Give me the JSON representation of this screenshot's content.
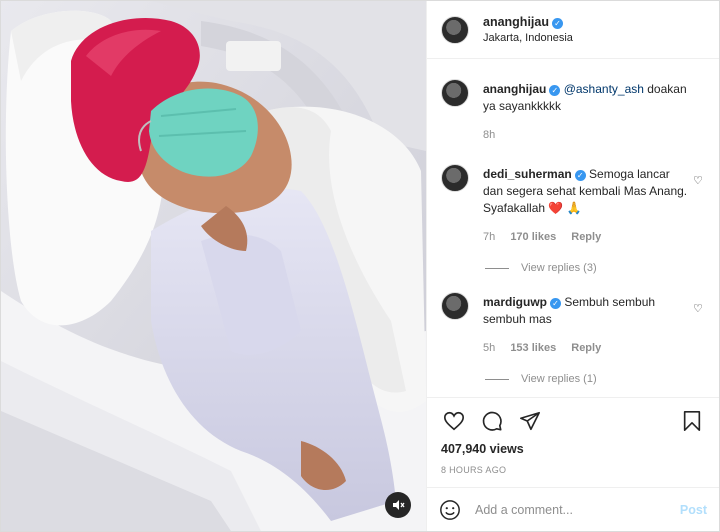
{
  "header": {
    "username": "ananghijau",
    "location": "Jakarta, Indonesia"
  },
  "caption": {
    "username": "ananghijau",
    "mention": "@ashanty_ash",
    "text": " doakan ya sayankkkkk",
    "time": "8h"
  },
  "comments": [
    {
      "username": "dedi_suherman",
      "text": "Semoga lancar dan segera sehat kembali Mas Anang. Syafakallah ❤️ 🙏",
      "time": "7h",
      "likes": "170 likes",
      "reply": "Reply",
      "view_replies": "View replies (3)"
    },
    {
      "username": "mardiguwp",
      "text": "Sembuh sembuh sembuh mas",
      "time": "5h",
      "likes": "153 likes",
      "reply": "Reply",
      "view_replies": "View replies (1)"
    }
  ],
  "stats": {
    "views": "407,940 views",
    "ago": "8 HOURS AGO"
  },
  "add_comment": {
    "placeholder": "Add a comment...",
    "post": "Post"
  },
  "icons": {
    "like": "heart-icon",
    "comment": "comment-icon",
    "share": "share-icon",
    "save": "bookmark-icon",
    "emoji": "emoji-icon",
    "mute": "speaker-mute-icon",
    "verified": "verified-badge-icon"
  },
  "colors": {
    "verified": "#3897f0",
    "post_disabled": "#b2dffc",
    "cap": "#d41c4e",
    "mask": "#6fd3c1",
    "gown": "#dcdcef"
  }
}
